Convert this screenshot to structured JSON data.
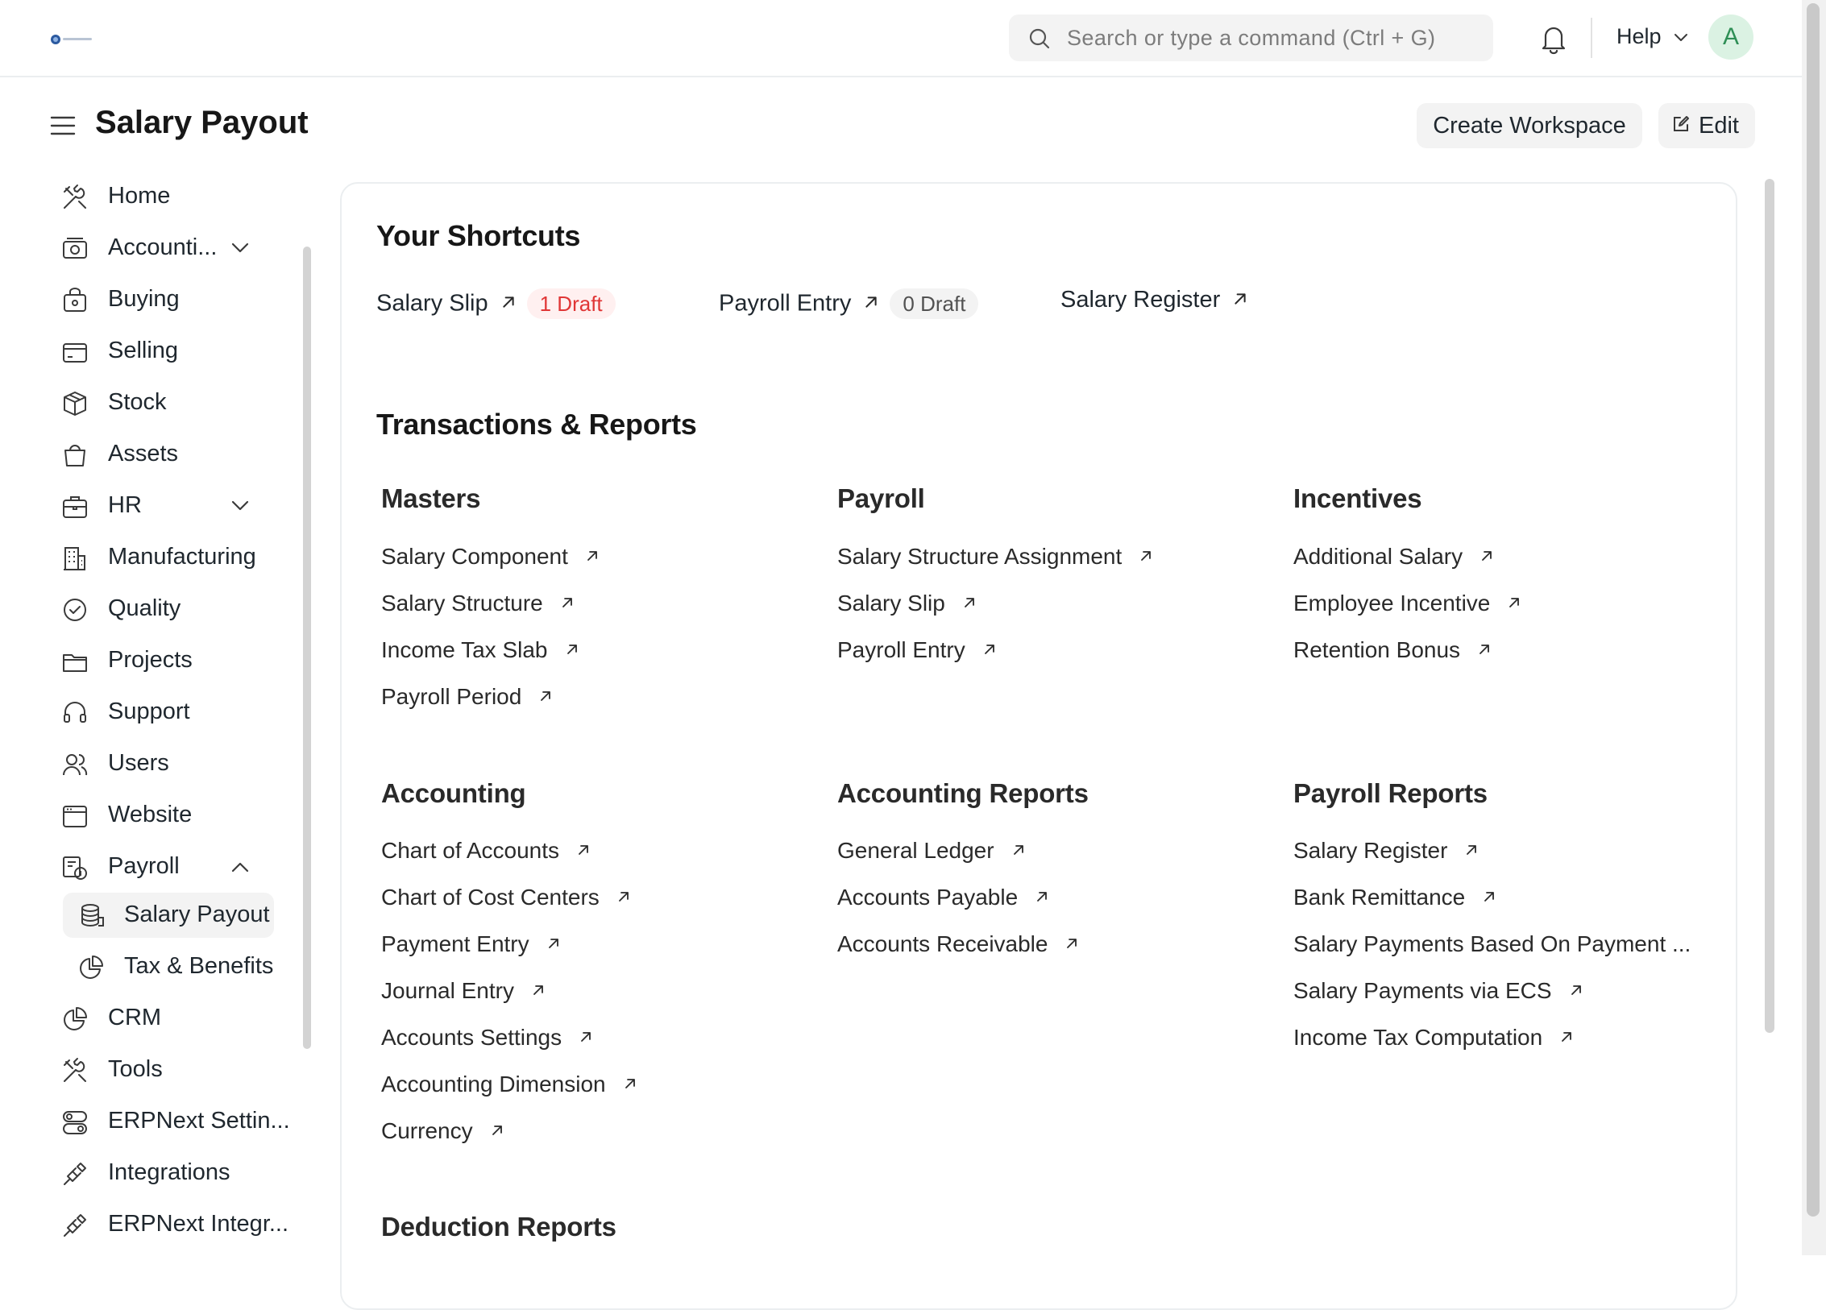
{
  "navbar": {
    "search_placeholder": "Search or type a command (Ctrl + G)",
    "help_label": "Help",
    "avatar_letter": "A"
  },
  "page": {
    "title": "Salary Payout",
    "create_workspace_label": "Create Workspace",
    "edit_label": "Edit"
  },
  "sidebar": {
    "items": [
      {
        "label": "Home",
        "icon": "tools-icon"
      },
      {
        "label": "Accounti...",
        "icon": "money-icon",
        "chevron": "down"
      },
      {
        "label": "Buying",
        "icon": "bag-icon"
      },
      {
        "label": "Selling",
        "icon": "card-icon"
      },
      {
        "label": "Stock",
        "icon": "box-icon"
      },
      {
        "label": "Assets",
        "icon": "basket-icon"
      },
      {
        "label": "HR",
        "icon": "briefcase-icon",
        "chevron": "down"
      },
      {
        "label": "Manufacturing",
        "icon": "building-icon"
      },
      {
        "label": "Quality",
        "icon": "badge-check-icon"
      },
      {
        "label": "Projects",
        "icon": "folder-icon"
      },
      {
        "label": "Support",
        "icon": "headset-icon"
      },
      {
        "label": "Users",
        "icon": "users-icon"
      },
      {
        "label": "Website",
        "icon": "browser-icon"
      },
      {
        "label": "Payroll",
        "icon": "payroll-icon",
        "chevron": "up"
      },
      {
        "label": "Salary Payout",
        "icon": "coins-icon",
        "active": true
      },
      {
        "label": "Tax & Benefits",
        "icon": "pie-icon"
      },
      {
        "label": "CRM",
        "icon": "crm-pie-icon"
      },
      {
        "label": "Tools",
        "icon": "tools-icon"
      },
      {
        "label": "ERPNext Settin...",
        "icon": "toggles-icon"
      },
      {
        "label": "Integrations",
        "icon": "plug-icon"
      },
      {
        "label": "ERPNext Integr...",
        "icon": "plug-icon"
      }
    ]
  },
  "shortcuts": {
    "heading": "Your Shortcuts",
    "items": [
      {
        "label": "Salary Slip",
        "badge": "1 Draft",
        "badge_color": "#e03636"
      },
      {
        "label": "Payroll Entry",
        "badge": "0 Draft",
        "badge_color": "#525252"
      },
      {
        "label": "Salary Register"
      }
    ]
  },
  "reports": {
    "heading": "Transactions & Reports",
    "cards": [
      {
        "title": "Masters",
        "links": [
          "Salary Component",
          "Salary Structure",
          "Income Tax Slab",
          "Payroll Period"
        ]
      },
      {
        "title": "Payroll",
        "links": [
          "Salary Structure Assignment",
          "Salary Slip",
          "Payroll Entry"
        ]
      },
      {
        "title": "Incentives",
        "links": [
          "Additional Salary",
          "Employee Incentive",
          "Retention Bonus"
        ]
      },
      {
        "title": "Accounting",
        "links": [
          "Chart of Accounts",
          "Chart of Cost Centers",
          "Payment Entry",
          "Journal Entry",
          "Accounts Settings",
          "Accounting Dimension",
          "Currency"
        ]
      },
      {
        "title": "Accounting Reports",
        "links": [
          "General Ledger",
          "Accounts Payable",
          "Accounts Receivable"
        ]
      },
      {
        "title": "Payroll Reports",
        "links": [
          "Salary Register",
          "Bank Remittance",
          "Salary Payments Based On Payment ...",
          "Salary Payments via ECS",
          "Income Tax Computation"
        ]
      },
      {
        "title": "Deduction Reports",
        "links": []
      }
    ]
  }
}
